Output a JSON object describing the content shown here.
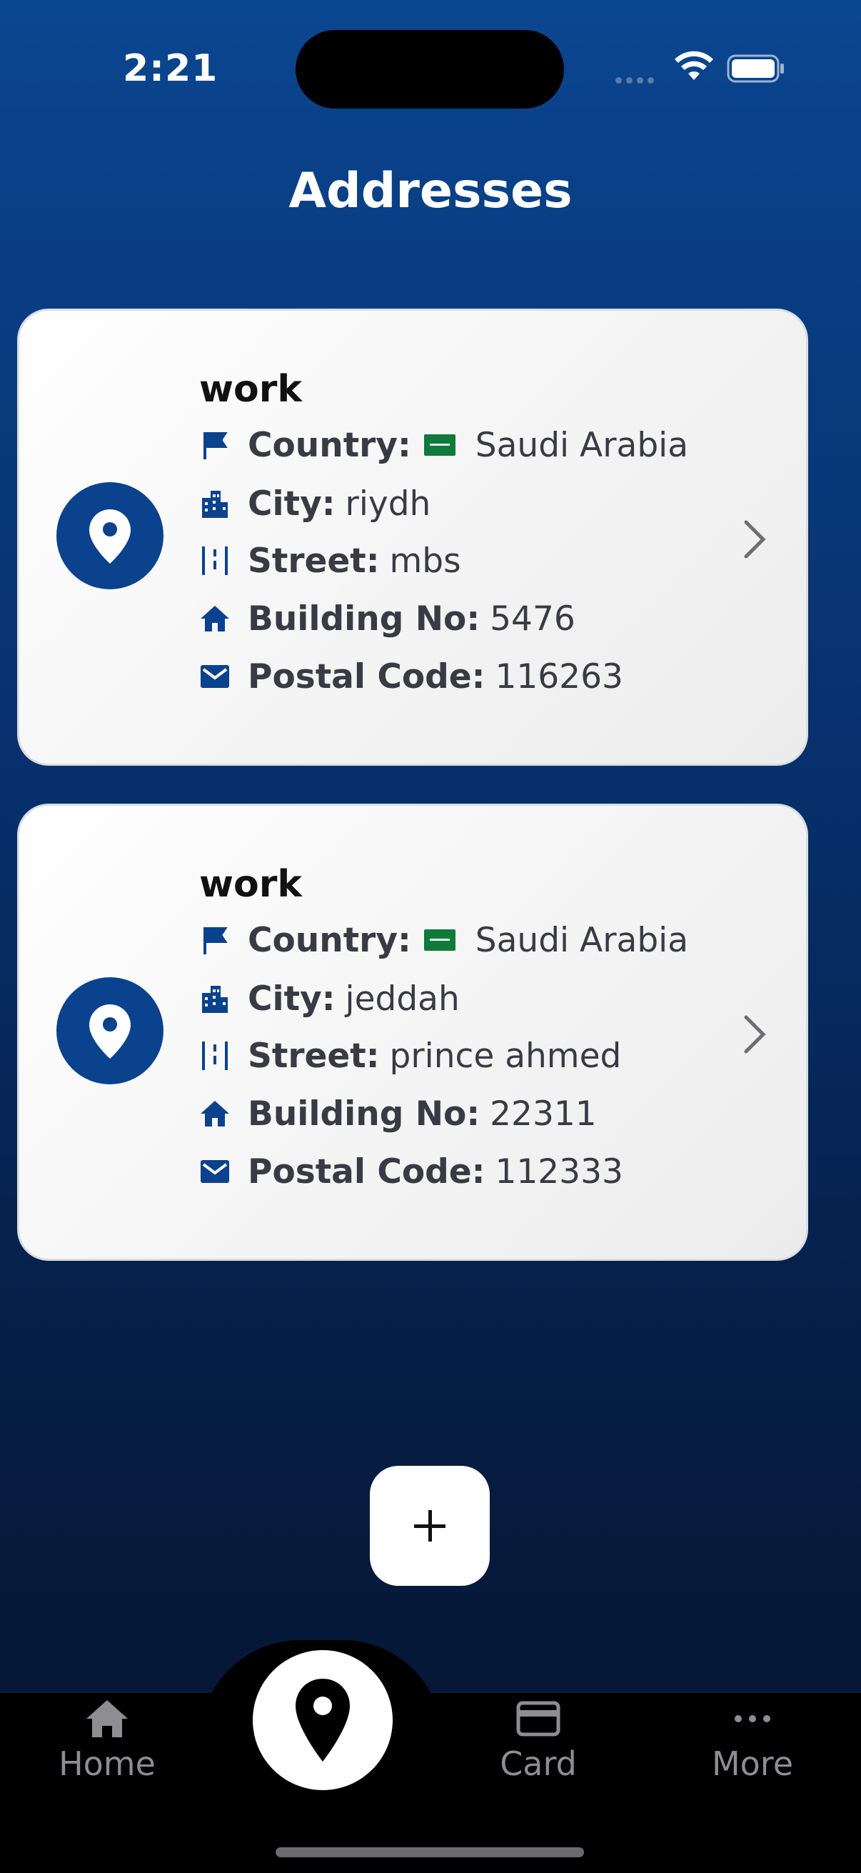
{
  "status_bar": {
    "time": "2:21"
  },
  "header": {
    "title": "Addresses"
  },
  "labels": {
    "country": "Country:",
    "city": "City:",
    "street": "Street:",
    "building": "Building No:",
    "postal": "Postal Code:"
  },
  "addresses": [
    {
      "name": "work",
      "country": "Saudi Arabia",
      "city": "riydh",
      "street": "mbs",
      "building": "5476",
      "postal": "116263"
    },
    {
      "name": "work",
      "country": "Saudi Arabia",
      "city": "jeddah",
      "street": "prince ahmed",
      "building": "22311",
      "postal": "112333"
    }
  ],
  "fab": {
    "icon": "plus-icon"
  },
  "nav": {
    "home": "Home",
    "card": "Card",
    "more": "More",
    "active": "addresses"
  },
  "colors": {
    "accent": "#0b428d",
    "background_top": "#0b4690",
    "background_bottom": "#05142e"
  }
}
